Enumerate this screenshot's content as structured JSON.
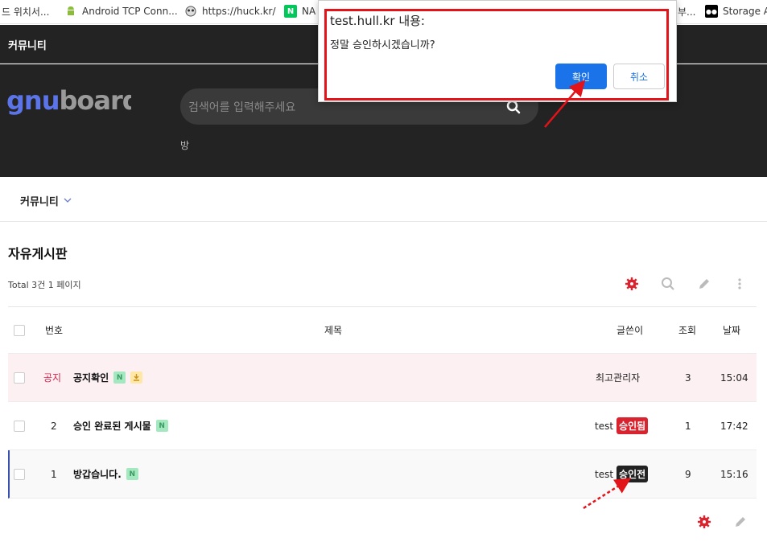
{
  "bookmarks": [
    {
      "label": "드 위치서...",
      "icon": "page-icon"
    },
    {
      "label": "Android TCP Conn...",
      "icon": "android-icon"
    },
    {
      "label": "https://huck.kr/",
      "icon": "raccoon-icon"
    },
    {
      "label": "NA",
      "icon": "naver-icon"
    },
    {
      "label": "부...",
      "icon": "page-icon"
    },
    {
      "label": "Storage A",
      "icon": "medium-icon"
    }
  ],
  "header": {
    "title": "커뮤니티"
  },
  "hero": {
    "logo": "gnuboard",
    "search_placeholder": "검색어를 입력해주세요",
    "sub_text": "방"
  },
  "nav": {
    "item": "커뮤니티"
  },
  "board": {
    "title": "자유게시판",
    "total": "Total 3건 1 페이지"
  },
  "table": {
    "headers": {
      "num": "번호",
      "subject": "제목",
      "author": "글쓴이",
      "views": "조회",
      "date": "날짜"
    },
    "rows": [
      {
        "num": "공지",
        "subject": "공지확인",
        "author": "최고관리자",
        "badge": "",
        "views": "3",
        "date": "15:04"
      },
      {
        "num": "2",
        "subject": "승인 완료된 게시물",
        "author": "test",
        "badge": "승인됨",
        "views": "1",
        "date": "17:42"
      },
      {
        "num": "1",
        "subject": "방갑습니다.",
        "author": "test",
        "badge": "승인전",
        "views": "9",
        "date": "15:16"
      }
    ],
    "new_icon": "N"
  },
  "dialog": {
    "title": "test.hull.kr 내용:",
    "message": "정말 승인하시겠습니까?",
    "ok": "확인",
    "cancel": "취소"
  },
  "colors": {
    "accent": "#1a73e8",
    "dark": "#232323",
    "approved": "#d9232f",
    "pending": "#222222",
    "highlight": "#e3131a"
  }
}
